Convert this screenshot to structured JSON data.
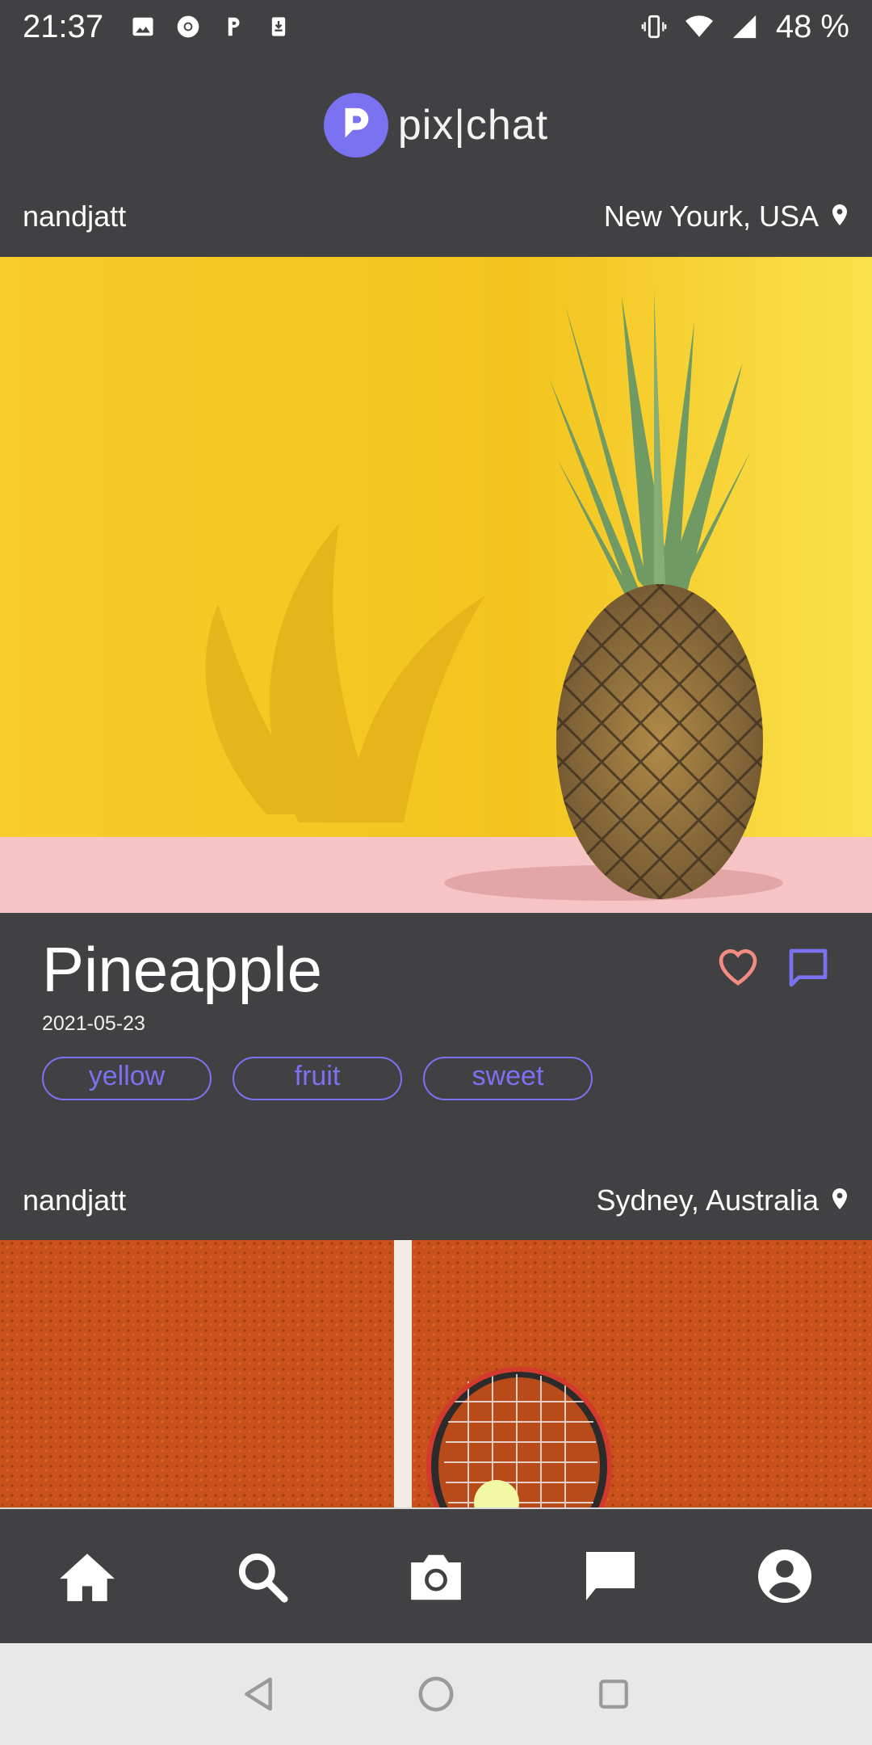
{
  "status_bar": {
    "time": "21:37",
    "battery": "48 %",
    "left_icons": [
      "image-icon",
      "chrome-icon",
      "parking-icon",
      "download-icon"
    ],
    "right_icons": [
      "vibrate-icon",
      "wifi-icon",
      "signal-icon"
    ]
  },
  "app": {
    "name": "pix|chat",
    "brand_color": "#7b72f2"
  },
  "posts": [
    {
      "user": "nandjatt",
      "location": "New Yourk, USA",
      "title": "Pineapple",
      "date": "2021-05-23",
      "tags": [
        "yellow",
        "fruit",
        "sweet"
      ],
      "liked_color": "#f28b82"
    },
    {
      "user": "nandjatt",
      "location": "Sydney, Australia"
    }
  ],
  "bottom_nav": [
    "home-icon",
    "search-icon",
    "camera-icon",
    "chat-icon",
    "profile-icon"
  ],
  "system_nav": [
    "back-icon",
    "home-circle-icon",
    "recents-icon"
  ]
}
